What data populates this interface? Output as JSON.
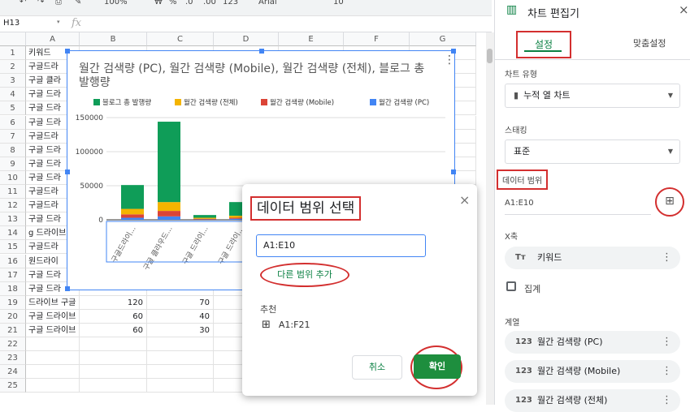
{
  "toolbar": {
    "zoom": "100%",
    "currency": "₩",
    "percent": "%",
    "dec_less": ".0",
    "dec_more": ".00",
    "format_more": "123",
    "font": "Arial",
    "font_size": "10"
  },
  "formula_bar": {
    "cell_ref": "H13",
    "fx": "fx"
  },
  "columns": [
    "A",
    "B",
    "C",
    "D",
    "E",
    "F",
    "G"
  ],
  "rows": [
    {
      "n": "1",
      "a": "키워드",
      "b": "",
      "c": ""
    },
    {
      "n": "2",
      "a": "구글드라",
      "b": "",
      "c": ""
    },
    {
      "n": "3",
      "a": "구글 클라",
      "b": "",
      "c": ""
    },
    {
      "n": "4",
      "a": "구글 드라",
      "b": "",
      "c": ""
    },
    {
      "n": "5",
      "a": "구글 드라",
      "b": "",
      "c": ""
    },
    {
      "n": "6",
      "a": "구글 드라",
      "b": "",
      "c": ""
    },
    {
      "n": "7",
      "a": "구글드라",
      "b": "",
      "c": ""
    },
    {
      "n": "8",
      "a": "구글 드라",
      "b": "",
      "c": ""
    },
    {
      "n": "9",
      "a": "구글 드라",
      "b": "",
      "c": ""
    },
    {
      "n": "10",
      "a": "구글 드라",
      "b": "",
      "c": ""
    },
    {
      "n": "11",
      "a": "구글드라",
      "b": "",
      "c": ""
    },
    {
      "n": "12",
      "a": "구글드라",
      "b": "",
      "c": ""
    },
    {
      "n": "13",
      "a": "구글 드라",
      "b": "",
      "c": ""
    },
    {
      "n": "14",
      "a": "g 드라이브",
      "b": "",
      "c": ""
    },
    {
      "n": "15",
      "a": "구글드라",
      "b": "",
      "c": ""
    },
    {
      "n": "16",
      "a": "원드라이",
      "b": "",
      "c": ""
    },
    {
      "n": "17",
      "a": "구글 드라",
      "b": "",
      "c": ""
    },
    {
      "n": "18",
      "a": "구글 드라",
      "b": "",
      "c": ""
    },
    {
      "n": "19",
      "a": "드라이브 구글",
      "b": "120",
      "c": "70"
    },
    {
      "n": "20",
      "a": "구글 드라이브",
      "b": "60",
      "c": "40"
    },
    {
      "n": "21",
      "a": "구글 드라이브",
      "b": "60",
      "c": "30"
    },
    {
      "n": "22",
      "a": "",
      "b": "",
      "c": ""
    },
    {
      "n": "23",
      "a": "",
      "b": "",
      "c": ""
    },
    {
      "n": "24",
      "a": "",
      "b": "",
      "c": ""
    },
    {
      "n": "25",
      "a": "",
      "b": "",
      "c": ""
    }
  ],
  "chart": {
    "title": "월간 검색량 (PC), 월간 검색량 (Mobile), 월간 검색량 (전체), 블로그 총 발행량",
    "kebab": "⋮"
  },
  "chart_data": {
    "type": "bar",
    "stacked": true,
    "title": "월간 검색량 (PC), 월간 검색량 (Mobile), 월간 검색량 (전체), 블로그 총 발행량",
    "categories": [
      "구글드라이...",
      "구글 클라우드...",
      "구글 드라이...",
      "구글 드라이..."
    ],
    "series": [
      {
        "name": "월간 검색량 (PC)",
        "color": "#4285f4",
        "values": [
          3000,
          5000,
          500,
          1500
        ]
      },
      {
        "name": "월간 검색량 (Mobile)",
        "color": "#db4437",
        "values": [
          5000,
          8000,
          1000,
          1500
        ]
      },
      {
        "name": "월간 검색량 (전체)",
        "color": "#f4b400",
        "values": [
          8000,
          13000,
          1500,
          3000
        ]
      },
      {
        "name": "블로그 총 발행량",
        "color": "#0f9d58",
        "values": [
          35000,
          118000,
          4000,
          20000
        ]
      }
    ],
    "legend_order": [
      "블로그 총 발행량",
      "월간 검색량 (전체)",
      "월간 검색량 (Mobile)",
      "월간 검색량 (PC)"
    ],
    "yticks": [
      "150000",
      "100000",
      "50000",
      "0"
    ],
    "ylim": [
      0,
      150000
    ],
    "legend_position": "top",
    "grid": true
  },
  "dialog": {
    "title": "데이터 범위 선택",
    "close": "×",
    "range_value": "A1:E10",
    "add_range": "다른 범위 추가",
    "suggest_header": "추천",
    "suggest_item": "A1:F21",
    "cancel": "취소",
    "ok": "확인"
  },
  "panel": {
    "title": "차트 편집기",
    "close": "×",
    "tab_setup": "설정",
    "tab_custom": "맞춤설정",
    "chart_type_label": "차트 유형",
    "chart_type_value": "누적 열 차트",
    "stacking_label": "스태킹",
    "stacking_value": "표준",
    "data_range_label": "데이터 범위",
    "data_range_value": "A1:E10",
    "x_axis_label": "X축",
    "x_axis_value": "키워드",
    "aggregate_label": "집계",
    "series_label": "계열",
    "series_items": [
      "월간 검색량 (PC)",
      "월간 검색량 (Mobile)",
      "월간 검색량 (전체)"
    ],
    "series_icon": "123",
    "x_icon": "Tт"
  }
}
